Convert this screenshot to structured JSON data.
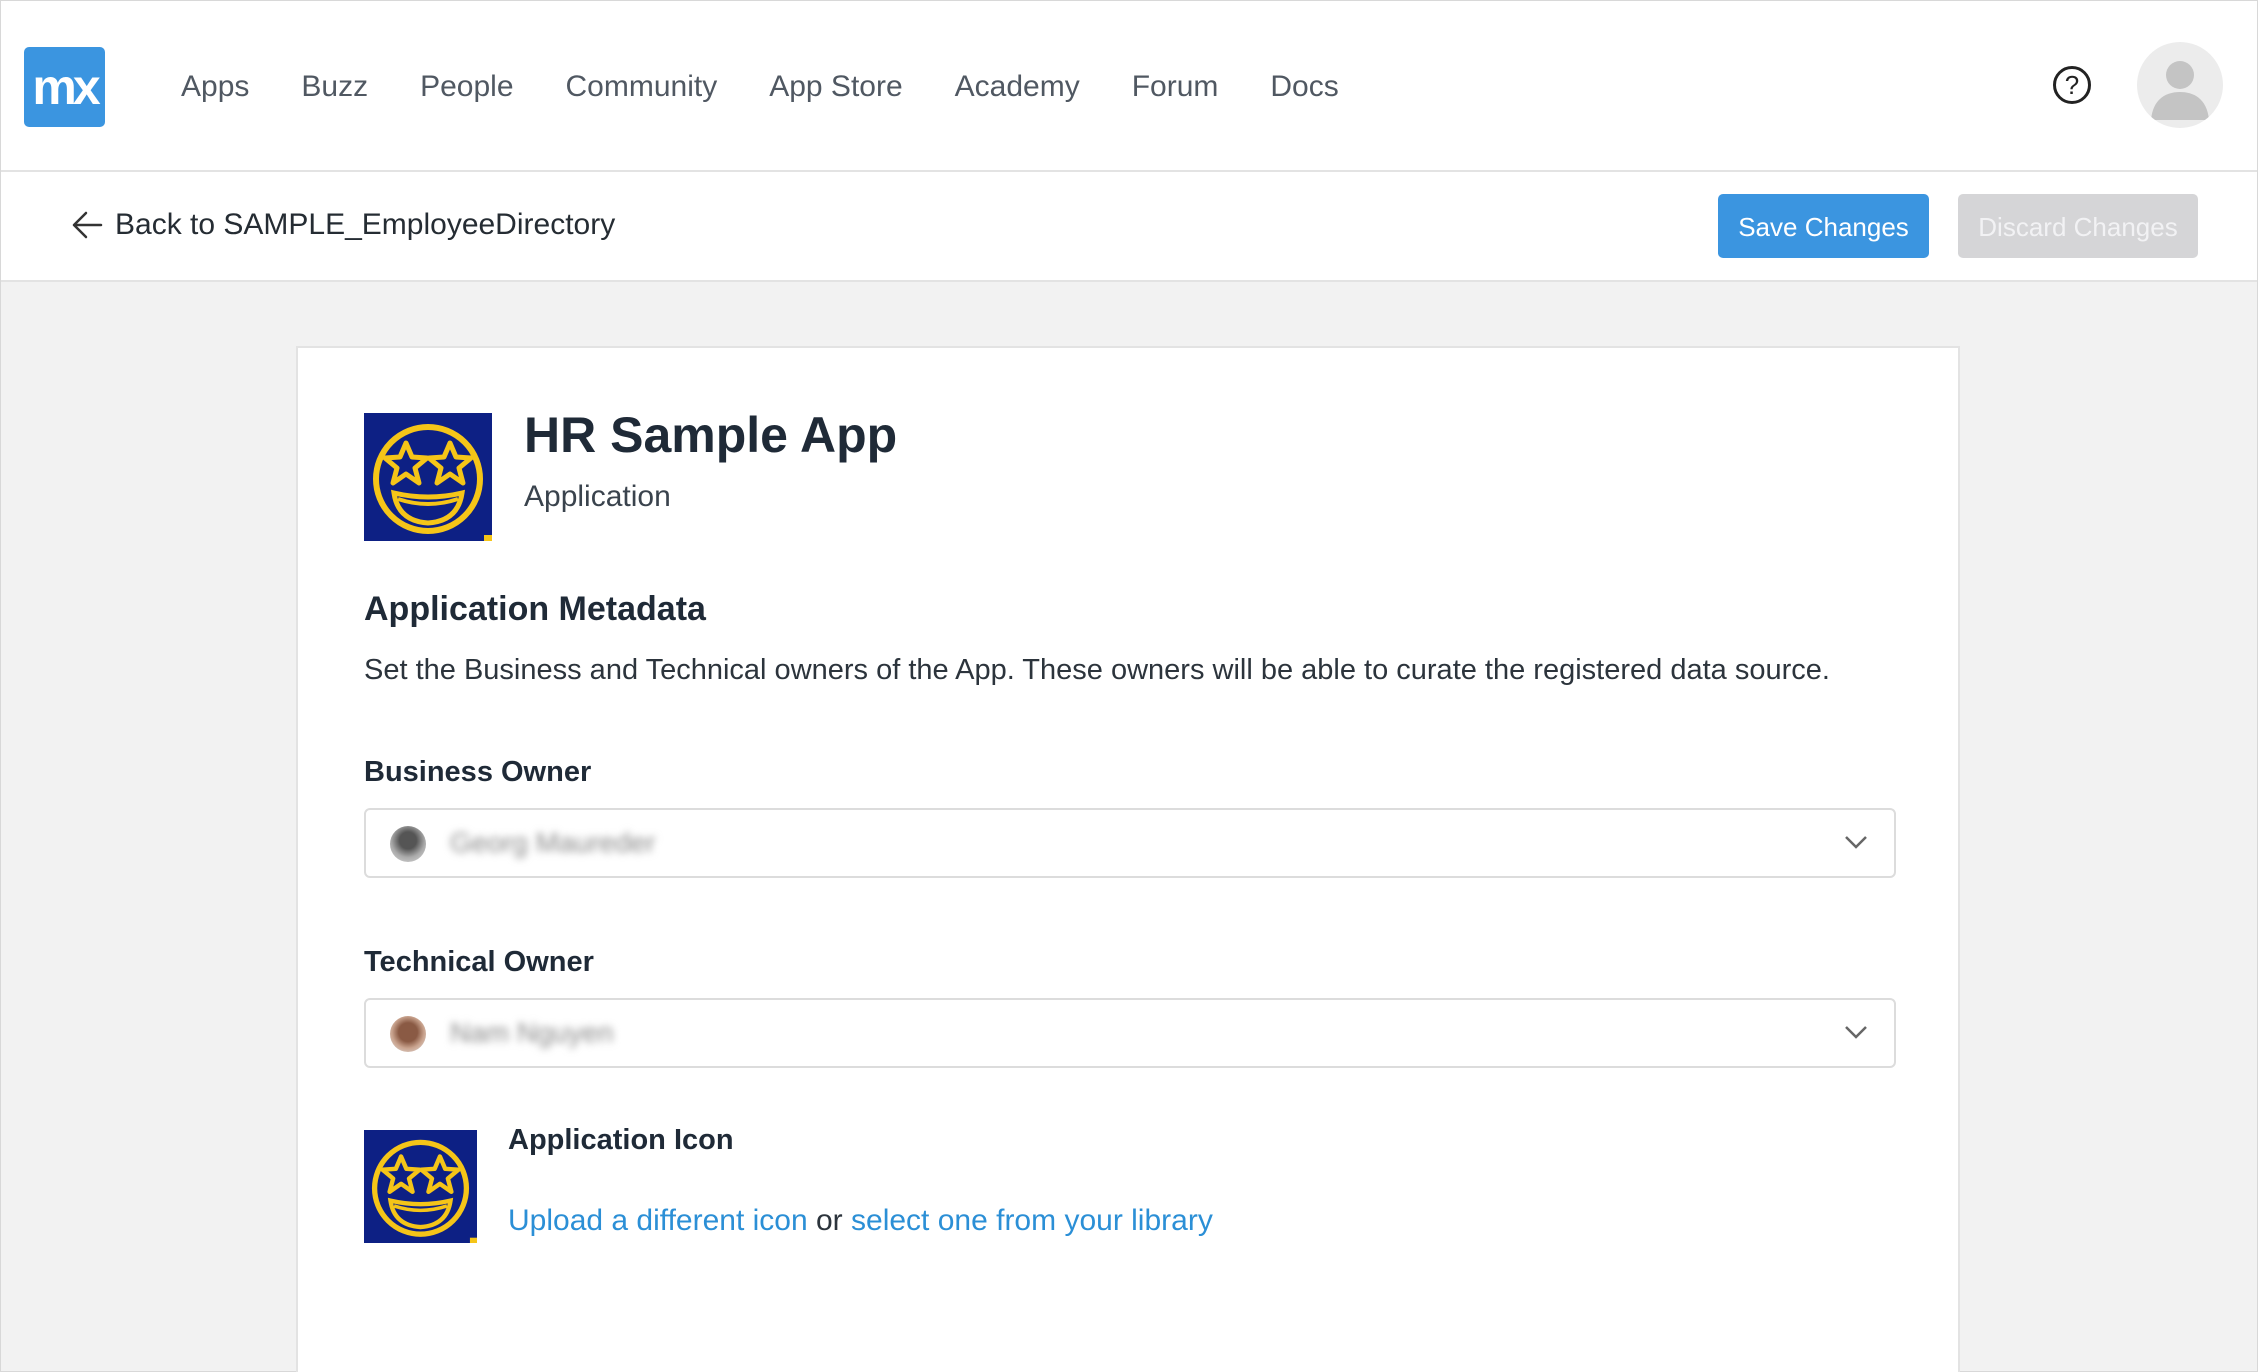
{
  "nav": {
    "logo_text": "mx",
    "items": [
      "Apps",
      "Buzz",
      "People",
      "Community",
      "App Store",
      "Academy",
      "Forum",
      "Docs"
    ],
    "help_glyph": "?"
  },
  "subbar": {
    "back_label": "Back to SAMPLE_EmployeeDirectory",
    "save_label": "Save Changes",
    "discard_label": "Discard Changes"
  },
  "app": {
    "title": "HR Sample App",
    "subtitle": "Application"
  },
  "metadata": {
    "heading": "Application Metadata",
    "description": "Set the Business and Technical owners of the App. These owners will be able to curate the registered data source.",
    "business_owner_label": "Business Owner",
    "business_owner_value": "Georg Maureder",
    "technical_owner_label": "Technical Owner",
    "technical_owner_value": "Nam Nguyen"
  },
  "icon_section": {
    "label": "Application Icon",
    "upload_link": "Upload a different icon",
    "or_text": " or ",
    "library_link": "select one from your library"
  },
  "colors": {
    "accent": "#3b95e0",
    "icon_bg": "#0d2084",
    "icon_fg": "#f5c518",
    "link": "#2b8fd6"
  }
}
